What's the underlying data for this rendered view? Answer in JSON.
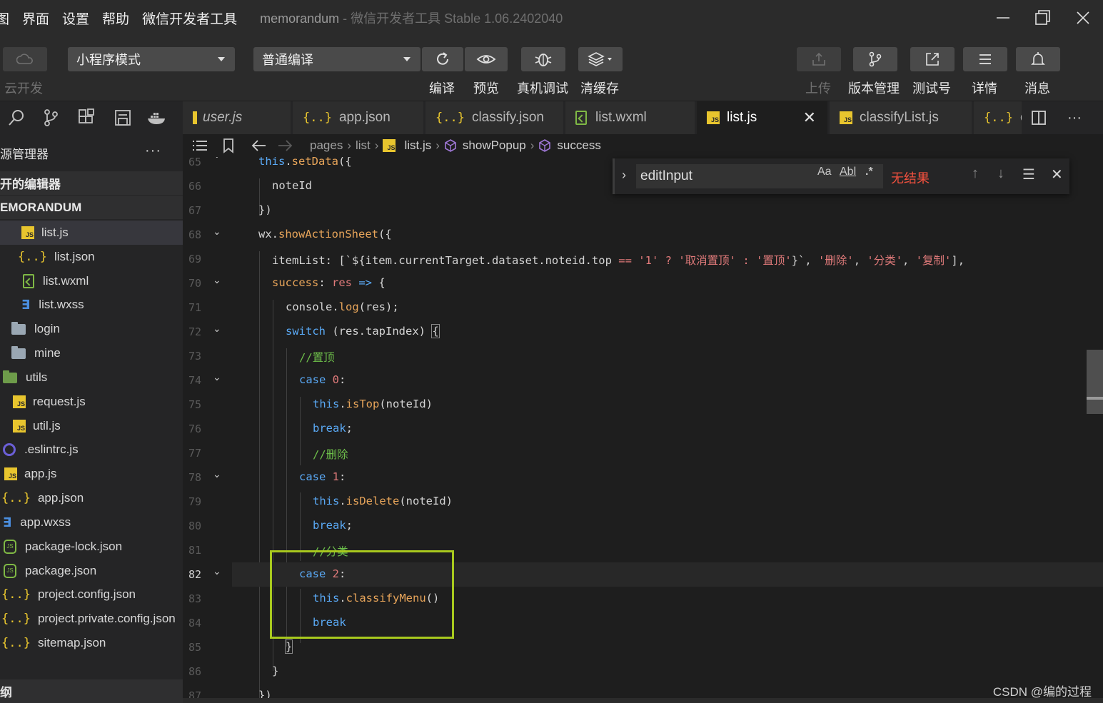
{
  "menu": {
    "items": [
      "图",
      "界面",
      "设置",
      "帮助",
      "微信开发者工具"
    ],
    "app_title": "memorandum",
    "app_subtitle": " - 微信开发者工具 Stable 1.06.2402040"
  },
  "toolbar": {
    "cloud_label": "云开发",
    "mode_select": "小程序模式",
    "compile_select": "普通编译",
    "compile_label": "编译",
    "preview_label": "预览",
    "debug_label": "真机调试",
    "cache_label": "清缓存",
    "upload_label": "上传",
    "version_label": "版本管理",
    "test_label": "测试号",
    "detail_label": "详情",
    "message_label": "消息"
  },
  "tabs": [
    {
      "label": "user.js",
      "icon": "js"
    },
    {
      "label": "app.json",
      "icon": "json"
    },
    {
      "label": "classify.json",
      "icon": "json"
    },
    {
      "label": "list.wxml",
      "icon": "wxml"
    },
    {
      "label": "list.js",
      "icon": "js",
      "active": true
    },
    {
      "label": "classifyList.js",
      "icon": "js"
    },
    {
      "label": "cl",
      "icon": "json"
    }
  ],
  "sidebar": {
    "title": "源管理器",
    "open_editors": "开的编辑器",
    "project": "EMORANDUM",
    "items": [
      {
        "label": "list.js",
        "icon": "js"
      },
      {
        "label": "list.json",
        "icon": "json"
      },
      {
        "label": "list.wxml",
        "icon": "wxml"
      },
      {
        "label": "list.wxss",
        "icon": "css"
      },
      {
        "label": "login",
        "icon": "folder"
      },
      {
        "label": "mine",
        "icon": "folder"
      },
      {
        "label": "utils",
        "icon": "folder-green"
      },
      {
        "label": "request.js",
        "icon": "js"
      },
      {
        "label": "util.js",
        "icon": "js"
      },
      {
        "label": ".eslintrc.js",
        "icon": "eslint"
      },
      {
        "label": "app.js",
        "icon": "js"
      },
      {
        "label": "app.json",
        "icon": "json"
      },
      {
        "label": "app.wxss",
        "icon": "css"
      },
      {
        "label": "package-lock.json",
        "icon": "node"
      },
      {
        "label": "package.json",
        "icon": "node"
      },
      {
        "label": "project.config.json",
        "icon": "json"
      },
      {
        "label": "project.private.config.json",
        "icon": "json"
      },
      {
        "label": "sitemap.json",
        "icon": "json"
      }
    ],
    "footer": "纲"
  },
  "breadcrumb": [
    "pages",
    "list",
    "list.js",
    "showPopup",
    "success"
  ],
  "find": {
    "value": "editInput",
    "match_case": "Aa",
    "whole_word": "Abl",
    "regex": ".*",
    "result": "无结果"
  },
  "code": {
    "line_numbers": [
      "65",
      "66",
      "67",
      "68",
      "69",
      "70",
      "71",
      "72",
      "73",
      "74",
      "75",
      "76",
      "77",
      "78",
      "79",
      "80",
      "81",
      "82",
      "83",
      "84",
      "85",
      "86",
      "87"
    ],
    "l65_a": "this",
    "l65_b": ".",
    "l65_c": "setData",
    "l65_d": "({",
    "l66": "noteId",
    "l67": "})",
    "l68_a": "wx.",
    "l68_b": "showActionSheet",
    "l68_c": "({",
    "l69_a": "itemList: [`${item.currentTarget.dataset.noteid.top ",
    "l69_op": "==",
    "l69_b": " ",
    "l69_s1": "'1'",
    "l69_c": " ",
    "l69_q": "?",
    "l69_d": " ",
    "l69_s2": "'取消置顶'",
    "l69_e": " ",
    "l69_colon": ":",
    "l69_f": " ",
    "l69_s3": "'置顶'",
    "l69_g": "}`, ",
    "l69_s4": "'删除'",
    "l69_h": ", ",
    "l69_s5": "'分类'",
    "l69_i": ", ",
    "l69_s6": "'复制'",
    "l69_j": "],",
    "l70_a": "success",
    "l70_b": ": ",
    "l70_c": "res",
    "l70_d": " ",
    "l70_e": "=>",
    "l70_f": " {",
    "l71_a": "console.",
    "l71_b": "log",
    "l71_c": "(res);",
    "l72_a": "switch",
    "l72_b": " (res.tapIndex) ",
    "l72_c": "{",
    "l73": "//置顶",
    "l74_a": "case",
    "l74_b": " ",
    "l74_c": "0",
    "l74_d": ":",
    "l75_a": "this",
    "l75_b": ".",
    "l75_c": "isTop",
    "l75_d": "(noteId)",
    "l76_a": "break",
    "l76_b": ";",
    "l77": "//删除",
    "l78_a": "case",
    "l78_b": " ",
    "l78_c": "1",
    "l78_d": ":",
    "l79_a": "this",
    "l79_b": ".",
    "l79_c": "isDelete",
    "l79_d": "(noteId)",
    "l80_a": "break",
    "l80_b": ";",
    "l81": "//分类",
    "l82_a": "case",
    "l82_b": " ",
    "l82_c": "2",
    "l82_d": ":",
    "l83_a": "this",
    "l83_b": ".",
    "l83_c": "classifyMenu",
    "l83_d": "()",
    "l84": "break",
    "l85": "}",
    "l86": "}",
    "l87": "})"
  },
  "watermark": "CSDN @编的过程",
  "colors": {
    "keyword": "#5aa9f5",
    "function": "#e8a55a",
    "string": "#e07a7a",
    "comment": "#6dbf4a",
    "highlight_box": "#a8c91e",
    "find_no_result": "#f0503e"
  }
}
